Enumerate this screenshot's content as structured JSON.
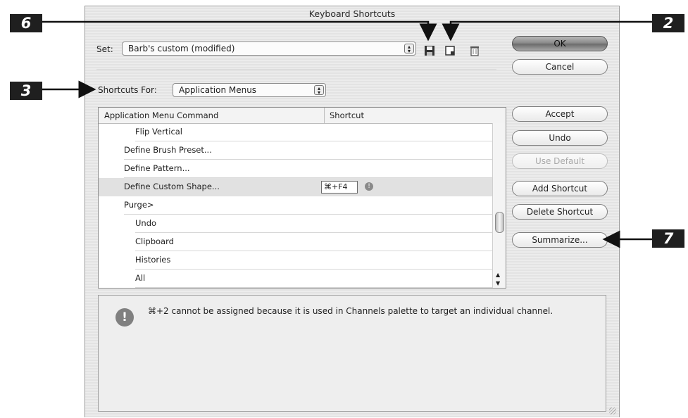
{
  "dialog": {
    "title": "Keyboard Shortcuts"
  },
  "set": {
    "label": "Set:",
    "value": "Barb's custom (modified)"
  },
  "shortcuts_for": {
    "label": "Shortcuts For:",
    "value": "Application Menus"
  },
  "table": {
    "headers": [
      "Application Menu Command",
      "Shortcut"
    ],
    "rows": [
      {
        "label": "Flip Vertical",
        "indent": 2,
        "shortcut": ""
      },
      {
        "label": "Define Brush Preset...",
        "indent": 1,
        "shortcut": ""
      },
      {
        "label": "Define Pattern...",
        "indent": 1,
        "shortcut": ""
      },
      {
        "label": "Define Custom Shape...",
        "indent": 1,
        "shortcut": "⌘+F4",
        "selected": true
      },
      {
        "label": "Purge>",
        "indent": 1,
        "shortcut": ""
      },
      {
        "label": "Undo",
        "indent": 2,
        "shortcut": ""
      },
      {
        "label": "Clipboard",
        "indent": 2,
        "shortcut": ""
      },
      {
        "label": "Histories",
        "indent": 2,
        "shortcut": ""
      },
      {
        "label": "All",
        "indent": 2,
        "shortcut": ""
      }
    ]
  },
  "buttons": {
    "ok": "OK",
    "cancel": "Cancel",
    "accept": "Accept",
    "undo": "Undo",
    "use_default": "Use Default",
    "add_shortcut": "Add Shortcut",
    "delete_shortcut": "Delete Shortcut",
    "summarize": "Summarize..."
  },
  "message": "⌘+2 cannot be assigned because it is used in Channels palette to target an individual channel.",
  "callouts": {
    "c6": "6",
    "c2": "2",
    "c3": "3",
    "c7": "7"
  },
  "icons": {
    "save": "save-set-icon",
    "new": "new-set-icon",
    "delete": "delete-set-icon",
    "warning": "warning-icon"
  }
}
